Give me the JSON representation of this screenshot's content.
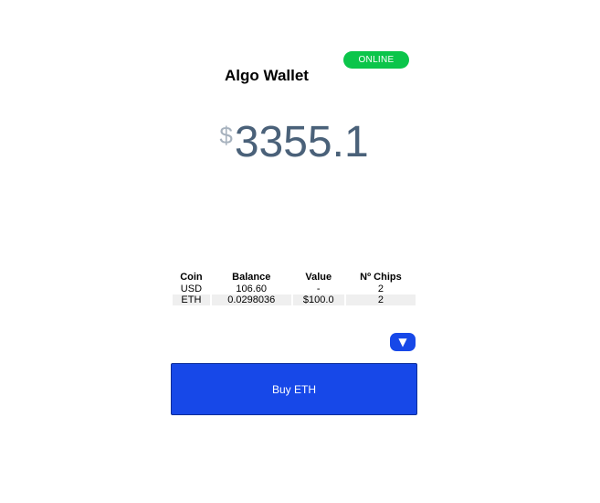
{
  "header": {
    "title": "Algo Wallet",
    "status": "ONLINE"
  },
  "balance": {
    "currency_symbol": "$",
    "amount": "3355.1"
  },
  "holdings": {
    "columns": [
      "Coin",
      "Balance",
      "Value",
      "Nº Chips"
    ],
    "rows": [
      [
        "USD",
        "106.60",
        "-",
        "2"
      ],
      [
        "ETH",
        "0.0298036",
        "$100.0",
        "2"
      ]
    ]
  },
  "controls": {
    "expand_icon": "▼",
    "buy_label": "Buy ETH"
  },
  "colors": {
    "status_green": "#0bc54a",
    "accent_blue": "#1748e8",
    "balance_text": "#4a6179",
    "currency_text": "#a7b2be"
  }
}
